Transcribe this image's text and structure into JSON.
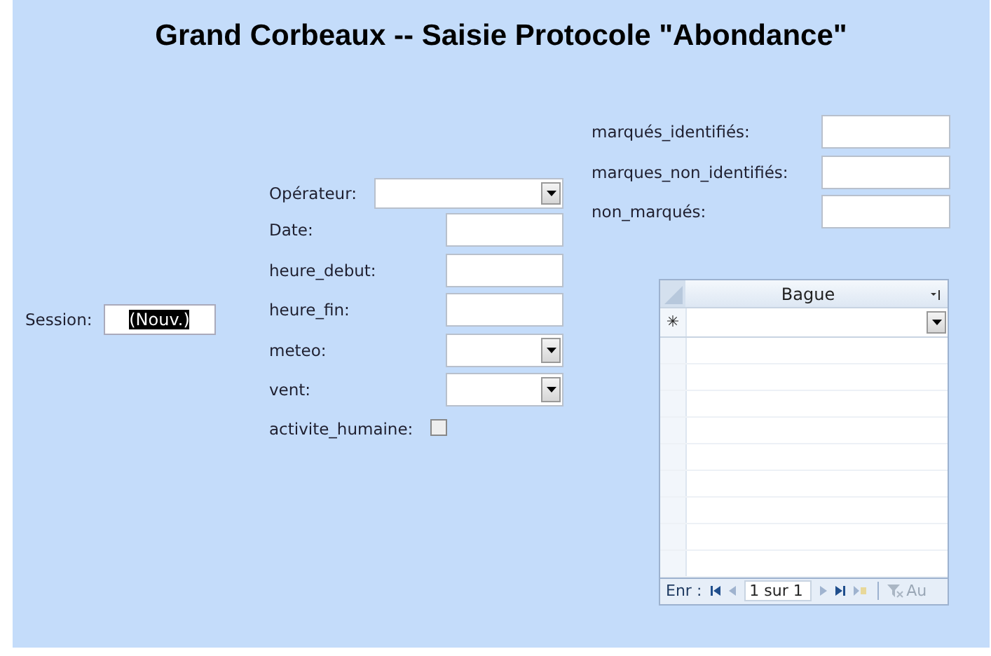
{
  "title": "Grand Corbeaux -- Saisie Protocole \"Abondance\"",
  "session": {
    "label": "Session:",
    "value": "(Nouv.)",
    "selected": true
  },
  "fields": [
    {
      "label": "Opérateur:",
      "kind": "combo"
    },
    {
      "label": "Date:",
      "kind": "text"
    },
    {
      "label": "heure_debut:",
      "kind": "text"
    },
    {
      "label": "heure_fin:",
      "kind": "text"
    },
    {
      "label": "meteo:",
      "kind": "combo"
    },
    {
      "label": "vent:",
      "kind": "combo"
    },
    {
      "label": "activite_humaine:",
      "kind": "checkbox",
      "checked": false
    }
  ],
  "counts": [
    {
      "label": "marqués_identifiés:"
    },
    {
      "label": "marques_non_identifiés:"
    },
    {
      "label": "non_marqués:"
    }
  ],
  "subform": {
    "column": "Bague",
    "new_row_marker": "✳",
    "record_label": "Enr :",
    "record_position": "1 sur 1",
    "filter": "Au"
  }
}
